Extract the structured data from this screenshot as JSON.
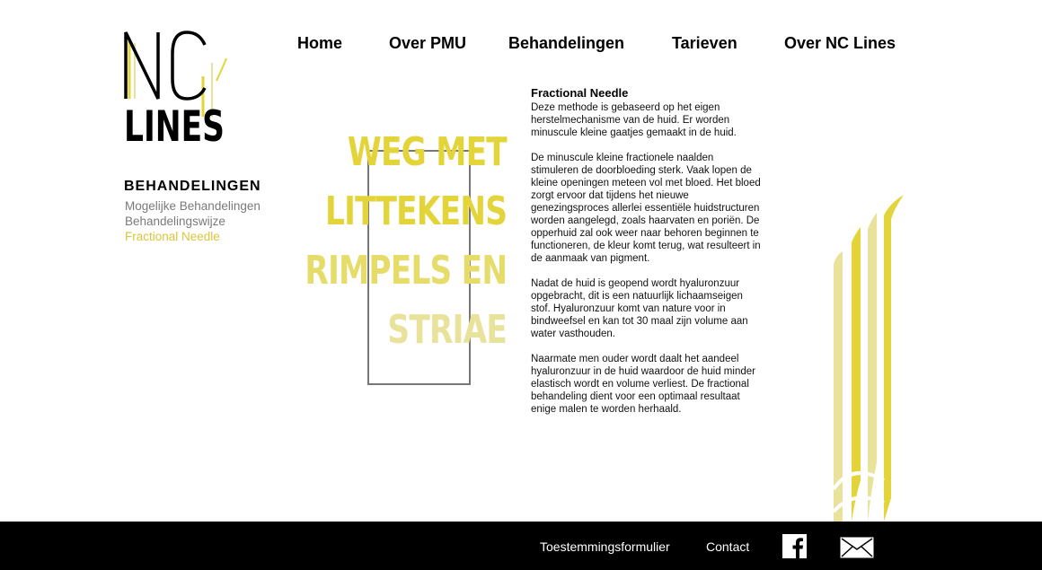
{
  "logo": {
    "line1": "NC",
    "line2": "LINES"
  },
  "nav": {
    "items": [
      "Home",
      "Over PMU",
      "Behandelingen",
      "Tarieven",
      "Over NC Lines"
    ]
  },
  "sidebar": {
    "title": "BEHANDELINGEN",
    "links": [
      {
        "label": "Mogelijke Behandelingen",
        "active": false
      },
      {
        "label": "Behandelingswijze",
        "active": false
      },
      {
        "label": "Fractional Needle",
        "active": true
      }
    ]
  },
  "hero": {
    "lines": [
      "WEG MET",
      "LITTEKENS",
      "RIMPELS EN",
      "STRIAE"
    ]
  },
  "article": {
    "title": "Fractional Needle",
    "paragraphs": [
      "Deze methode is gebaseerd op het eigen herstelmechanisme van de huid. Er worden minuscule kleine gaatjes gemaakt in de huid.",
      "De minuscule kleine fractionele naalden stimuleren de doorbloeding sterk. Vaak lopen de kleine openingen meteen vol met bloed. Het bloed zorgt ervoor dat tijdens het nieuwe genezingsproces allerlei essentiële huidstructuren worden aangelegd, zoals haarvaten en poriën. De opperhuid zal ook weer naar behoren beginnen te functioneren, de kleur komt terug, wat resulteert in de aanmaak van pigment.",
      "Nadat de huid is geopend wordt hyaluronzuur opgebracht, dit is een natuurlijk lichaamseigen stof. Hyaluronzuur komt van nature voor in bindweefsel en kan tot 30 maal zijn volume aan water vasthouden.",
      "Naarmate men ouder wordt daalt het aandeel hyaluronzuur in de huid waardoor de huid minder elastisch wordt en volume verliest. De fractional behandeling dient voor een optimaal resultaat enige malen te worden herhaald."
    ]
  },
  "footer": {
    "consent": "Toestemmingsformulier",
    "contact": "Contact",
    "facebook_icon": "facebook-icon",
    "mail_icon": "mail-icon"
  },
  "colors": {
    "accent": "#e3d43a",
    "accent_light": "#e8e29a",
    "text": "#000000",
    "muted": "#7a7a7a",
    "footer_bg": "#000000"
  }
}
